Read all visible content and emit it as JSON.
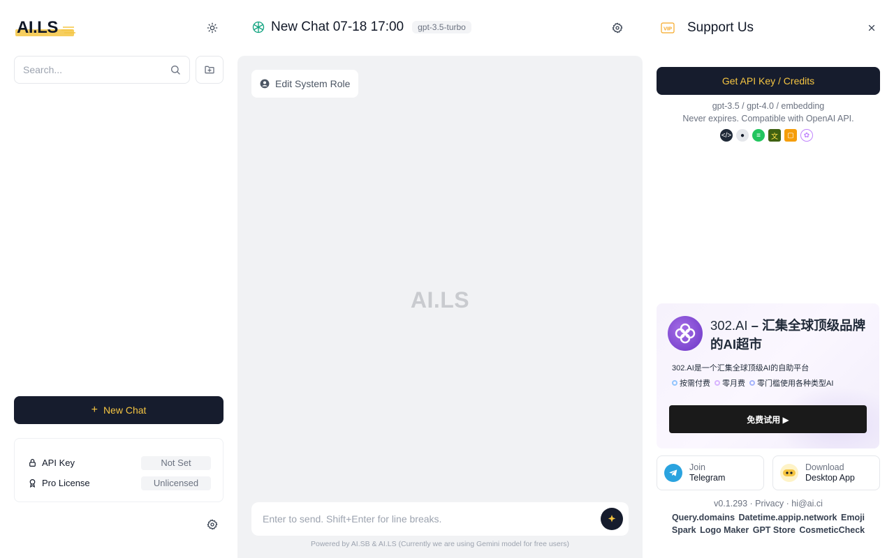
{
  "left": {
    "logo_text": "AI.LS",
    "search_placeholder": "Search...",
    "new_chat_label": "New Chat",
    "settings": [
      {
        "label": "API Key",
        "value": "Not Set",
        "icon": "lock-icon"
      },
      {
        "label": "Pro License",
        "value": "Unlicensed",
        "icon": "award-icon"
      }
    ]
  },
  "chat": {
    "title": "New Chat 07-18 17:00",
    "model": "gpt-3.5-turbo",
    "system_role_label": "Edit System Role",
    "watermark": "AI.LS",
    "input_placeholder": "Enter to send. Shift+Enter for line breaks.",
    "powered_by": "Powered by AI.SB & AI.LS (Currently we are using Gemini model for free users)"
  },
  "support": {
    "vip_label": "VIP",
    "title": "Support Us",
    "api_button": "Get API Key / Credits",
    "desc_line1": "gpt-3.5 / gpt-4.0 / embedding",
    "desc_line2": "Never expires. Compatible with OpenAI API.",
    "promo": {
      "brand": "302.AI",
      "title_rest": " – 汇集全球顶级品牌的AI超市",
      "subtitle": "302.AI是一个汇集全球顶级AI的自助平台",
      "tags": [
        "按需付费",
        "零月费",
        "零门槛使用各种类型AI"
      ],
      "button": "免费试用 ▶"
    },
    "telegram": {
      "line1": "Join",
      "line2": "Telegram"
    },
    "desktop": {
      "line1": "Download",
      "line2": "Desktop App"
    },
    "version_line": "v0.1.293 · Privacy · hi@ai.ci",
    "links": [
      "Query.domains",
      "Datetime.appip.network",
      "Emoji",
      "Spark",
      "Logo Maker",
      "GPT Store",
      "CosmeticCheck"
    ]
  },
  "colors": {
    "accent": "#f5c542",
    "dark": "#161c2d",
    "chat_bg": "#f1f2f4"
  }
}
